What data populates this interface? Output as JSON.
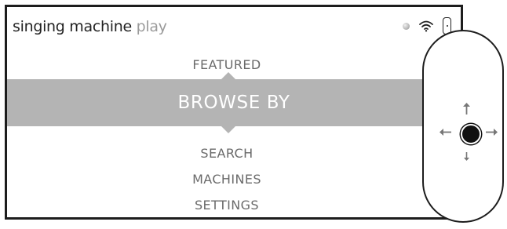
{
  "header": {
    "brand_main": "singing machine ",
    "brand_accent": "play"
  },
  "status_icons": [
    "status-dot-icon",
    "wifi-icon",
    "battery-icon"
  ],
  "menu": {
    "above": [
      "FEATURED"
    ],
    "selected": "BROWSE BY",
    "below": [
      "SEARCH",
      "MACHINES",
      "SETTINGS"
    ]
  },
  "dpad": {
    "icons": [
      "arrow-up-icon",
      "arrow-left-icon",
      "center-button-icon",
      "arrow-right-icon",
      "arrow-down-icon"
    ]
  },
  "colors": {
    "frame": "#1d1d1d",
    "highlight_band": "#b4b4b4",
    "menu_text": "#6a6a6a",
    "brand_accent": "#9b9b9b"
  }
}
